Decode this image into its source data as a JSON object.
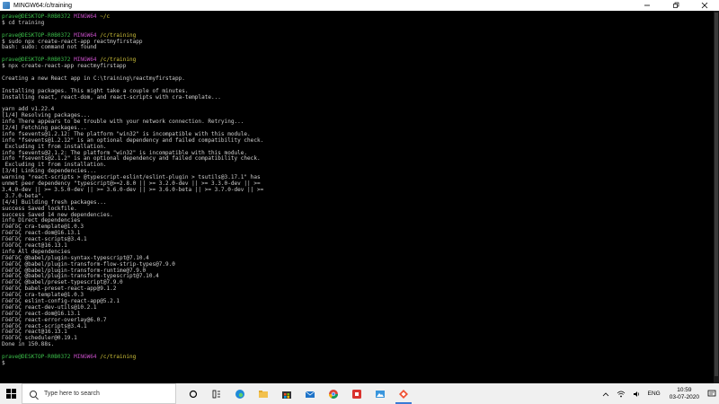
{
  "window": {
    "title": "MINGW64:/c/training",
    "icon": "git-bash-icon",
    "controls": [
      "minimize-icon",
      "maximize-icon",
      "close-icon"
    ]
  },
  "terminal": {
    "lines": [
      [
        {
          "c": "u",
          "t": "prave@DESKTOP-R0B0372 "
        },
        {
          "c": "h",
          "t": "MINGW64 "
        },
        {
          "c": "p",
          "t": "~/c"
        }
      ],
      [
        {
          "c": "t",
          "t": "$ cd training"
        }
      ],
      [
        {
          "c": "t",
          "t": ""
        }
      ],
      [
        {
          "c": "u",
          "t": "prave@DESKTOP-R0B0372 "
        },
        {
          "c": "h",
          "t": "MINGW64 "
        },
        {
          "c": "p",
          "t": "/c/training"
        }
      ],
      [
        {
          "c": "t",
          "t": "$ sudo npx create-react-app reactmyfirstapp"
        }
      ],
      [
        {
          "c": "t",
          "t": "bash: sudo: command not found"
        }
      ],
      [
        {
          "c": "t",
          "t": ""
        }
      ],
      [
        {
          "c": "u",
          "t": "prave@DESKTOP-R0B0372 "
        },
        {
          "c": "h",
          "t": "MINGW64 "
        },
        {
          "c": "p",
          "t": "/c/training"
        }
      ],
      [
        {
          "c": "t",
          "t": "$ npx create-react-app reactmyfirstapp"
        }
      ],
      [
        {
          "c": "t",
          "t": ""
        }
      ],
      [
        {
          "c": "t",
          "t": "Creating a new React app in C:\\training\\reactmyfirstapp."
        }
      ],
      [
        {
          "c": "t",
          "t": ""
        }
      ],
      [
        {
          "c": "t",
          "t": "Installing packages. This might take a couple of minutes."
        }
      ],
      [
        {
          "c": "t",
          "t": "Installing react, react-dom, and react-scripts with cra-template..."
        }
      ],
      [
        {
          "c": "t",
          "t": ""
        }
      ],
      [
        {
          "c": "t",
          "t": "yarn add v1.22.4"
        }
      ],
      [
        {
          "c": "t",
          "t": "[1/4] Resolving packages..."
        }
      ],
      [
        {
          "c": "t",
          "t": "info There appears to be trouble with your network connection. Retrying..."
        }
      ],
      [
        {
          "c": "t",
          "t": "[2/4] Fetching packages..."
        }
      ],
      [
        {
          "c": "t",
          "t": "info fsevents@1.2.12: The platform \"win32\" is incompatible with this module."
        }
      ],
      [
        {
          "c": "t",
          "t": "info \"fsevents@1.2.12\" is an optional dependency and failed compatibility check."
        }
      ],
      [
        {
          "c": "t",
          "t": " Excluding it from installation."
        }
      ],
      [
        {
          "c": "t",
          "t": "info fsevents@2.1.2: The platform \"win32\" is incompatible with this module."
        }
      ],
      [
        {
          "c": "t",
          "t": "info \"fsevents@2.1.2\" is an optional dependency and failed compatibility check."
        }
      ],
      [
        {
          "c": "t",
          "t": " Excluding it from installation."
        }
      ],
      [
        {
          "c": "t",
          "t": "[3/4] Linking dependencies..."
        }
      ],
      [
        {
          "c": "t",
          "t": "warning \"react-scripts > @typescript-eslint/eslint-plugin > tsutils@3.17.1\" has"
        }
      ],
      [
        {
          "c": "t",
          "t": "unmet peer dependency \"typescript@>=2.8.0 || >= 3.2.0-dev || >= 3.3.0-dev || >="
        }
      ],
      [
        {
          "c": "t",
          "t": "3.4.0-dev || >= 3.5.0-dev || >= 3.6.0-dev || >= 3.6.0-beta || >= 3.7.0-dev || >="
        }
      ],
      [
        {
          "c": "t",
          "t": " 3.7.0-beta\"."
        }
      ],
      [
        {
          "c": "t",
          "t": "[4/4] Building fresh packages..."
        }
      ],
      [
        {
          "c": "t",
          "t": "success Saved lockfile."
        }
      ],
      [
        {
          "c": "t",
          "t": "success Saved 14 new dependencies."
        }
      ],
      [
        {
          "c": "t",
          "t": "info Direct dependencies"
        }
      ],
      [
        {
          "c": "t",
          "t": "ΓöéΓöÇ cra-template@1.0.3"
        }
      ],
      [
        {
          "c": "t",
          "t": "ΓöéΓöÇ react-dom@16.13.1"
        }
      ],
      [
        {
          "c": "t",
          "t": "ΓöéΓöÇ react-scripts@3.4.1"
        }
      ],
      [
        {
          "c": "t",
          "t": "ΓööΓöÇ react@16.13.1"
        }
      ],
      [
        {
          "c": "t",
          "t": "info All dependencies"
        }
      ],
      [
        {
          "c": "t",
          "t": "ΓöéΓöÇ @babel/plugin-syntax-typescript@7.10.4"
        }
      ],
      [
        {
          "c": "t",
          "t": "ΓöéΓöÇ @babel/plugin-transform-flow-strip-types@7.9.0"
        }
      ],
      [
        {
          "c": "t",
          "t": "ΓöéΓöÇ @babel/plugin-transform-runtime@7.9.0"
        }
      ],
      [
        {
          "c": "t",
          "t": "ΓöéΓöÇ @babel/plugin-transform-typescript@7.10.4"
        }
      ],
      [
        {
          "c": "t",
          "t": "ΓöéΓöÇ @babel/preset-typescript@7.9.0"
        }
      ],
      [
        {
          "c": "t",
          "t": "ΓöéΓöÇ babel-preset-react-app@9.1.2"
        }
      ],
      [
        {
          "c": "t",
          "t": "ΓöéΓöÇ cra-template@1.0.3"
        }
      ],
      [
        {
          "c": "t",
          "t": "ΓöéΓöÇ eslint-config-react-app@5.2.1"
        }
      ],
      [
        {
          "c": "t",
          "t": "ΓöéΓöÇ react-dev-utils@10.2.1"
        }
      ],
      [
        {
          "c": "t",
          "t": "ΓöéΓöÇ react-dom@16.13.1"
        }
      ],
      [
        {
          "c": "t",
          "t": "ΓöéΓöÇ react-error-overlay@6.0.7"
        }
      ],
      [
        {
          "c": "t",
          "t": "ΓöéΓöÇ react-scripts@3.4.1"
        }
      ],
      [
        {
          "c": "t",
          "t": "ΓöéΓöÇ react@16.13.1"
        }
      ],
      [
        {
          "c": "t",
          "t": "ΓööΓöÇ scheduler@0.19.1"
        }
      ],
      [
        {
          "c": "t",
          "t": "Done in 150.88s."
        }
      ],
      [
        {
          "c": "t",
          "t": ""
        }
      ],
      [
        {
          "c": "u",
          "t": "prave@DESKTOP-R0B0372 "
        },
        {
          "c": "h",
          "t": "MINGW64 "
        },
        {
          "c": "p",
          "t": "/c/training"
        }
      ],
      [
        {
          "c": "t",
          "t": "$ "
        }
      ]
    ],
    "colors": {
      "user": "#3cc04b",
      "host": "#c64ec6",
      "path": "#d1c33a",
      "text": "#cfcfcf",
      "background": "#000000"
    }
  },
  "taskbar": {
    "search_placeholder": "Type here to search",
    "apps": [
      {
        "icon": "task-view-icon",
        "active": false
      },
      {
        "icon": "widgets-icon",
        "active": false
      },
      {
        "icon": "edge-icon",
        "active": false
      },
      {
        "icon": "file-explorer-icon",
        "active": false
      },
      {
        "icon": "store-icon",
        "active": false
      },
      {
        "icon": "mail-icon",
        "active": false
      },
      {
        "icon": "chrome-icon",
        "active": false
      },
      {
        "icon": "app-red-icon",
        "active": false
      },
      {
        "icon": "photos-icon",
        "active": false
      },
      {
        "icon": "git-bash-icon",
        "active": true
      }
    ],
    "tray": {
      "language": "ENG",
      "time": "10:59",
      "date": "03-07-2020"
    }
  }
}
